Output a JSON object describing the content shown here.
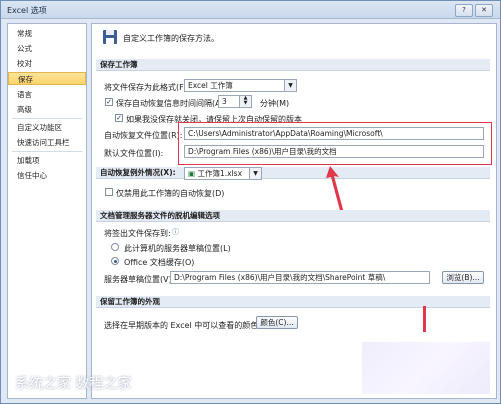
{
  "window": {
    "title": "Excel 选项",
    "help_label": "?",
    "close_label": "✕"
  },
  "sidebar": {
    "items": [
      {
        "label": "常规"
      },
      {
        "label": "公式"
      },
      {
        "label": "校对"
      },
      {
        "label": "保存"
      },
      {
        "label": "语言"
      },
      {
        "label": "高级"
      },
      {
        "label": "自定义功能区"
      },
      {
        "label": "快速访问工具栏"
      },
      {
        "label": "加载项"
      },
      {
        "label": "信任中心"
      }
    ],
    "selected": "保存"
  },
  "header": {
    "text": "自定义工作簿的保存方法。",
    "icon": "save-disk-icon"
  },
  "save_workbooks": {
    "heading": "保存工作簿",
    "format_label": "将文件保存为此格式(F):",
    "format_value": "Excel 工作簿",
    "autorecover_label": "保存自动恢复信息时间间隔(A)",
    "autorecover_checked": true,
    "autorecover_minutes": "3",
    "minutes_label": "分钟(M)",
    "keep_last_label": "如果我没保存就关闭，请保留上次自动保留的版本",
    "keep_last_checked": true,
    "autorecover_location_label": "自动恢复文件位置(R):",
    "autorecover_location_value": "C:\\Users\\Administrator\\AppData\\Roaming\\Microsoft\\",
    "default_location_label": "默认文件位置(I):",
    "default_location_value": "D:\\Program Files (x86)\\用户目录\\我的文档"
  },
  "autorecover_exceptions": {
    "label": "自动恢复例外情况(X):",
    "workbook": "工作簿1.xlsx",
    "disable_label": "仅禁用此工作簿的自动恢复(D)",
    "disable_checked": false
  },
  "offline_editing": {
    "heading": "文档管理服务器文件的脱机编辑选项",
    "save_to_label": "将签出文件保存到:",
    "option_server": "此计算机的服务器草稿位置(L)",
    "option_cache": "Office 文档缓存(O)",
    "selected": "Office 文档缓存(O)",
    "drafts_label": "服务器草稿位置(V):",
    "drafts_value": "D:\\Program Files (x86)\\用户目录\\我的文档\\SharePoint 草稿\\",
    "browse_label": "浏览(B)..."
  },
  "preserve_visual": {
    "heading": "保留工作簿的外观",
    "colors_label": "选择在早期版本的 Excel 中可以查看的颜色:",
    "colors_button": "颜色(C)..."
  },
  "watermark": "系统之家 数程之家",
  "colors": {
    "annotation_red": "#e0384a",
    "selection_yellow": "#fbd36a"
  }
}
